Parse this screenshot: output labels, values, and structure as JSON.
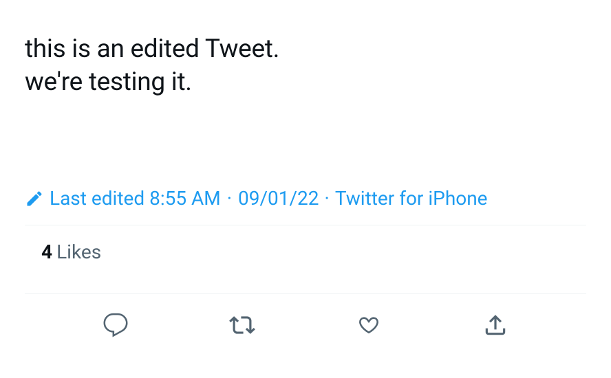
{
  "tweet": {
    "text_line1": "this is an edited Tweet.",
    "text_line2": "we're testing it."
  },
  "meta": {
    "edited_prefix": "Last edited",
    "time": "8:55 AM",
    "date": "09/01/22",
    "source": "Twitter for iPhone",
    "separator": "·"
  },
  "stats": {
    "likes_count": "4",
    "likes_label": "Likes"
  },
  "colors": {
    "link": "#1d9bf0",
    "text": "#0f1419",
    "muted": "#536471"
  }
}
